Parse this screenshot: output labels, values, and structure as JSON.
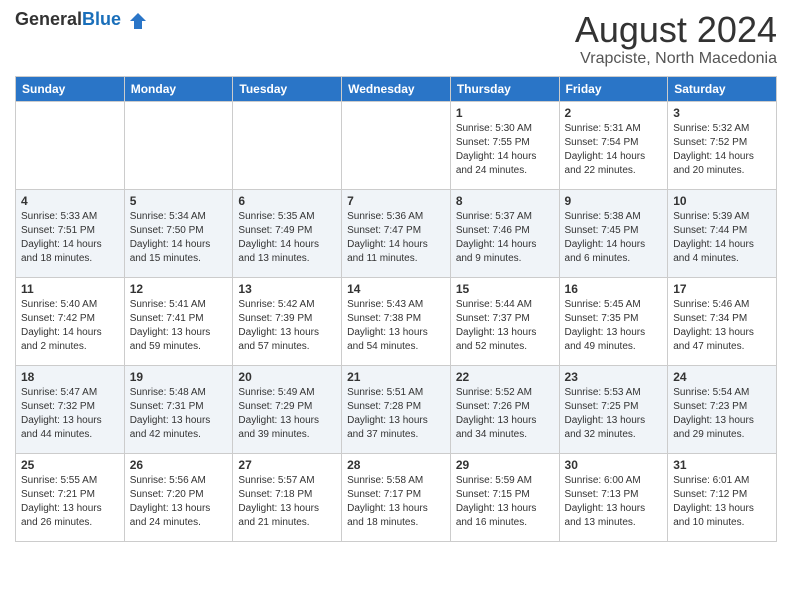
{
  "header": {
    "logo_general": "General",
    "logo_blue": "Blue",
    "month_title": "August 2024",
    "location": "Vrapciste, North Macedonia"
  },
  "weekdays": [
    "Sunday",
    "Monday",
    "Tuesday",
    "Wednesday",
    "Thursday",
    "Friday",
    "Saturday"
  ],
  "weeks": [
    [
      {
        "day": "",
        "info": ""
      },
      {
        "day": "",
        "info": ""
      },
      {
        "day": "",
        "info": ""
      },
      {
        "day": "",
        "info": ""
      },
      {
        "day": "1",
        "info": "Sunrise: 5:30 AM\nSunset: 7:55 PM\nDaylight: 14 hours\nand 24 minutes."
      },
      {
        "day": "2",
        "info": "Sunrise: 5:31 AM\nSunset: 7:54 PM\nDaylight: 14 hours\nand 22 minutes."
      },
      {
        "day": "3",
        "info": "Sunrise: 5:32 AM\nSunset: 7:52 PM\nDaylight: 14 hours\nand 20 minutes."
      }
    ],
    [
      {
        "day": "4",
        "info": "Sunrise: 5:33 AM\nSunset: 7:51 PM\nDaylight: 14 hours\nand 18 minutes."
      },
      {
        "day": "5",
        "info": "Sunrise: 5:34 AM\nSunset: 7:50 PM\nDaylight: 14 hours\nand 15 minutes."
      },
      {
        "day": "6",
        "info": "Sunrise: 5:35 AM\nSunset: 7:49 PM\nDaylight: 14 hours\nand 13 minutes."
      },
      {
        "day": "7",
        "info": "Sunrise: 5:36 AM\nSunset: 7:47 PM\nDaylight: 14 hours\nand 11 minutes."
      },
      {
        "day": "8",
        "info": "Sunrise: 5:37 AM\nSunset: 7:46 PM\nDaylight: 14 hours\nand 9 minutes."
      },
      {
        "day": "9",
        "info": "Sunrise: 5:38 AM\nSunset: 7:45 PM\nDaylight: 14 hours\nand 6 minutes."
      },
      {
        "day": "10",
        "info": "Sunrise: 5:39 AM\nSunset: 7:44 PM\nDaylight: 14 hours\nand 4 minutes."
      }
    ],
    [
      {
        "day": "11",
        "info": "Sunrise: 5:40 AM\nSunset: 7:42 PM\nDaylight: 14 hours\nand 2 minutes."
      },
      {
        "day": "12",
        "info": "Sunrise: 5:41 AM\nSunset: 7:41 PM\nDaylight: 13 hours\nand 59 minutes."
      },
      {
        "day": "13",
        "info": "Sunrise: 5:42 AM\nSunset: 7:39 PM\nDaylight: 13 hours\nand 57 minutes."
      },
      {
        "day": "14",
        "info": "Sunrise: 5:43 AM\nSunset: 7:38 PM\nDaylight: 13 hours\nand 54 minutes."
      },
      {
        "day": "15",
        "info": "Sunrise: 5:44 AM\nSunset: 7:37 PM\nDaylight: 13 hours\nand 52 minutes."
      },
      {
        "day": "16",
        "info": "Sunrise: 5:45 AM\nSunset: 7:35 PM\nDaylight: 13 hours\nand 49 minutes."
      },
      {
        "day": "17",
        "info": "Sunrise: 5:46 AM\nSunset: 7:34 PM\nDaylight: 13 hours\nand 47 minutes."
      }
    ],
    [
      {
        "day": "18",
        "info": "Sunrise: 5:47 AM\nSunset: 7:32 PM\nDaylight: 13 hours\nand 44 minutes."
      },
      {
        "day": "19",
        "info": "Sunrise: 5:48 AM\nSunset: 7:31 PM\nDaylight: 13 hours\nand 42 minutes."
      },
      {
        "day": "20",
        "info": "Sunrise: 5:49 AM\nSunset: 7:29 PM\nDaylight: 13 hours\nand 39 minutes."
      },
      {
        "day": "21",
        "info": "Sunrise: 5:51 AM\nSunset: 7:28 PM\nDaylight: 13 hours\nand 37 minutes."
      },
      {
        "day": "22",
        "info": "Sunrise: 5:52 AM\nSunset: 7:26 PM\nDaylight: 13 hours\nand 34 minutes."
      },
      {
        "day": "23",
        "info": "Sunrise: 5:53 AM\nSunset: 7:25 PM\nDaylight: 13 hours\nand 32 minutes."
      },
      {
        "day": "24",
        "info": "Sunrise: 5:54 AM\nSunset: 7:23 PM\nDaylight: 13 hours\nand 29 minutes."
      }
    ],
    [
      {
        "day": "25",
        "info": "Sunrise: 5:55 AM\nSunset: 7:21 PM\nDaylight: 13 hours\nand 26 minutes."
      },
      {
        "day": "26",
        "info": "Sunrise: 5:56 AM\nSunset: 7:20 PM\nDaylight: 13 hours\nand 24 minutes."
      },
      {
        "day": "27",
        "info": "Sunrise: 5:57 AM\nSunset: 7:18 PM\nDaylight: 13 hours\nand 21 minutes."
      },
      {
        "day": "28",
        "info": "Sunrise: 5:58 AM\nSunset: 7:17 PM\nDaylight: 13 hours\nand 18 minutes."
      },
      {
        "day": "29",
        "info": "Sunrise: 5:59 AM\nSunset: 7:15 PM\nDaylight: 13 hours\nand 16 minutes."
      },
      {
        "day": "30",
        "info": "Sunrise: 6:00 AM\nSunset: 7:13 PM\nDaylight: 13 hours\nand 13 minutes."
      },
      {
        "day": "31",
        "info": "Sunrise: 6:01 AM\nSunset: 7:12 PM\nDaylight: 13 hours\nand 10 minutes."
      }
    ]
  ]
}
